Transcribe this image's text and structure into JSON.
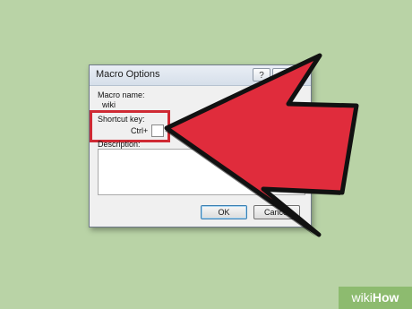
{
  "dialog": {
    "title": "Macro Options",
    "help_glyph": "?",
    "close_glyph": "x",
    "macro_name_label": "Macro name:",
    "macro_name_value": "wiki",
    "shortcut_key_label": "Shortcut key:",
    "ctrl_label": "Ctrl+",
    "description_label": "Description:",
    "ok_label": "OK",
    "cancel_label": "Cancel"
  },
  "annotation": {
    "arrow_color": "#e02c3c",
    "highlight_color": "#cf2a34",
    "arrow_icon": "pointer-arrow-icon"
  },
  "branding": {
    "prefix": "wiki",
    "suffix": "How"
  },
  "colors": {
    "background": "#b9d3a6"
  }
}
